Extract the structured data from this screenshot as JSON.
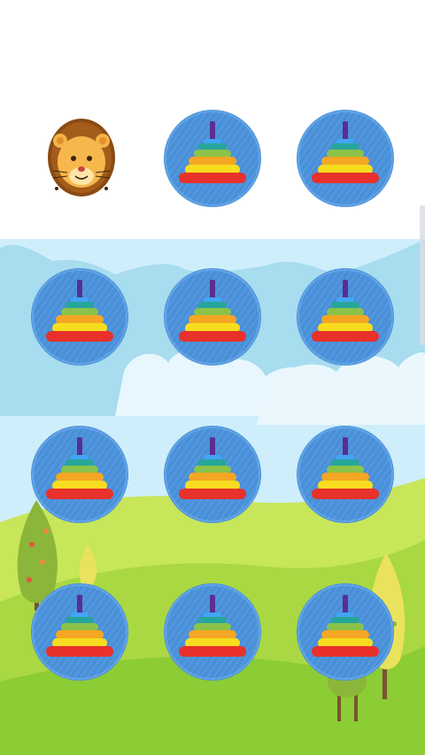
{
  "colors": {
    "sky_top": "#ffffff",
    "sky_band": "#cfeefb",
    "hill_far": "#a8dcef",
    "cloud": "#e8f7fd",
    "grass_light": "#c7e65a",
    "grass_mid": "#9dd13a",
    "grass_dark": "#7cc22d",
    "card_blue": "#4a90d9",
    "card_blue_light": "#6fb0ee",
    "ring_colors": [
      "#e8312a",
      "#f39c12",
      "#f7dc1f",
      "#f5a623",
      "#8bc34a",
      "#26a69a",
      "#42a5f5",
      "#5c2d91"
    ]
  },
  "board": {
    "rows": 4,
    "cols": 3,
    "revealed_index": 0,
    "cards": [
      {
        "face": "lion-icon",
        "revealed": true
      },
      {
        "face": "ring-pyramid-icon",
        "revealed": false
      },
      {
        "face": "ring-pyramid-icon",
        "revealed": false
      },
      {
        "face": "ring-pyramid-icon",
        "revealed": false
      },
      {
        "face": "ring-pyramid-icon",
        "revealed": false
      },
      {
        "face": "ring-pyramid-icon",
        "revealed": false
      },
      {
        "face": "ring-pyramid-icon",
        "revealed": false
      },
      {
        "face": "ring-pyramid-icon",
        "revealed": false
      },
      {
        "face": "ring-pyramid-icon",
        "revealed": false
      },
      {
        "face": "ring-pyramid-icon",
        "revealed": false
      },
      {
        "face": "ring-pyramid-icon",
        "revealed": false
      },
      {
        "face": "ring-pyramid-icon",
        "revealed": false
      }
    ]
  }
}
